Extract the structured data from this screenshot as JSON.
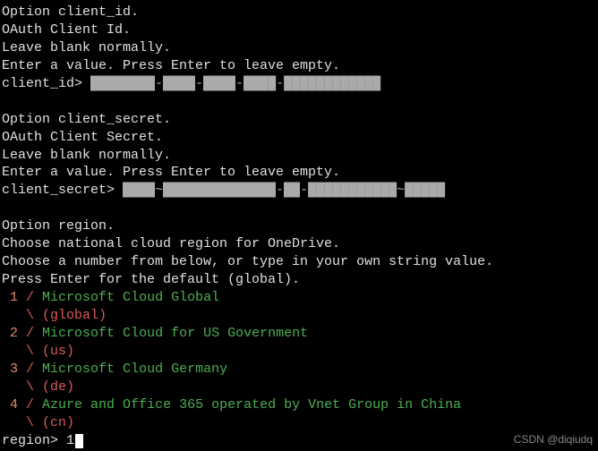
{
  "sections": {
    "client_id": {
      "opt_line": "Option client_id.",
      "title": "OAuth Client Id.",
      "blank": "Leave blank normally.",
      "enter": "Enter a value. Press Enter to leave empty.",
      "prompt": "client_id> ",
      "value": "████████-████-████-████-████████████"
    },
    "client_secret": {
      "opt_line": "Option client_secret.",
      "title": "OAuth Client Secret.",
      "blank": "Leave blank normally.",
      "enter": "Enter a value. Press Enter to leave empty.",
      "prompt": "client_secret> ",
      "value": "████~██████████████-██-███████████~█████"
    },
    "region": {
      "opt_line": "Option region.",
      "desc": "Choose national cloud region for OneDrive.",
      "choose": "Choose a number from below, or type in your own string value.",
      "default": "Press Enter for the default (global).",
      "options": [
        {
          "num": "1",
          "sep": " / ",
          "label": "Microsoft Cloud Global",
          "pipe": "   \\ ",
          "code": "(global)"
        },
        {
          "num": "2",
          "sep": " / ",
          "label": "Microsoft Cloud for US Government",
          "pipe": "   \\ ",
          "code": "(us)"
        },
        {
          "num": "3",
          "sep": " / ",
          "label": "Microsoft Cloud Germany",
          "pipe": "   \\ ",
          "code": "(de)"
        },
        {
          "num": "4",
          "sep": " / ",
          "label": "Azure and Office 365 operated by Vnet Group in China",
          "pipe": "   \\ ",
          "code": "(cn)"
        }
      ],
      "prompt": "region> ",
      "input": "1"
    }
  },
  "watermark": "CSDN @diqiudq"
}
